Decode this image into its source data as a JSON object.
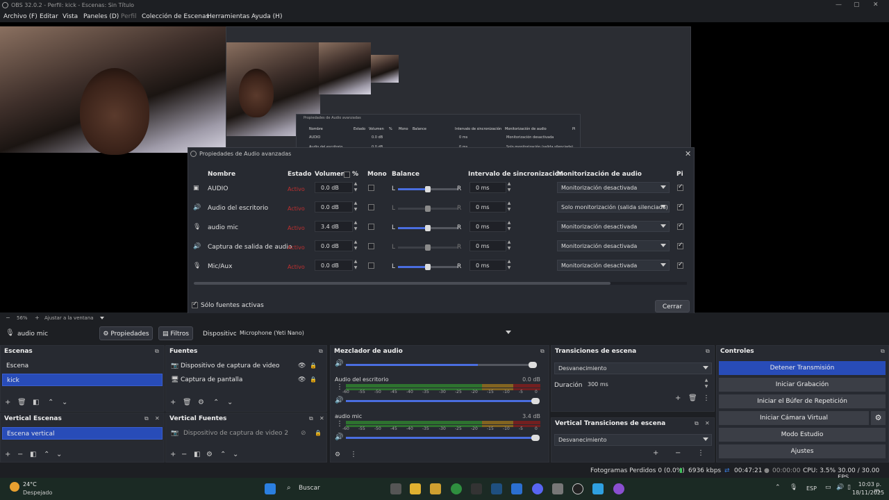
{
  "window": {
    "title": "OBS 32.0.2 - Perfil: kick - Escenas: Sin Título"
  },
  "menu": [
    "Archivo (F)",
    "Editar",
    "Vista",
    "Paneles (D)",
    "Perfil",
    "Colección de Escenas",
    "Herramientas",
    "Ayuda (H)"
  ],
  "nested_preview": {
    "dialog_title": "Propiedades de Audio avanzadas",
    "headers": [
      "Nombre",
      "Estado",
      "Volumen",
      "%",
      "Mono",
      "Balance",
      "Intervalo de sincronización",
      "Monitorización de audio",
      "Pi"
    ],
    "row1": {
      "name": "AUDIO",
      "vol": "0.0 dB",
      "ms": "0 ms",
      "monitor": "Monitorización desactivada"
    },
    "row2": {
      "name": "Audio del escritorio",
      "vol": "0.0 dB",
      "ms": "0 ms",
      "monitor": "Solo monitorización (salida silenciada)"
    }
  },
  "dialog": {
    "title": "Propiedades de Audio avanzadas",
    "headers": {
      "name": "Nombre",
      "state": "Estado",
      "volume": "Volumen",
      "percent": "%",
      "mono": "Mono",
      "balance": "Balance",
      "sync": "Intervalo de sincronización",
      "monitor": "Monitorización de audio",
      "pi": "Pi"
    },
    "balance_left": "L",
    "balance_right": "R",
    "rows": [
      {
        "icon": "source-icon",
        "name": "AUDIO",
        "state": "Activo",
        "volume": "0.0 dB",
        "mono": false,
        "balance_active": true,
        "balance": 0.5,
        "sync": "0 ms",
        "monitor": "Monitorización desactivada",
        "track": true
      },
      {
        "icon": "speaker-icon",
        "name": "Audio del escritorio",
        "state": "Activo",
        "volume": "0.0 dB",
        "mono": false,
        "balance_active": false,
        "balance": 0.5,
        "sync": "0 ms",
        "monitor": "Solo monitorización (salida silenciada)",
        "track": true
      },
      {
        "icon": "mic-icon",
        "name": "audio mic",
        "state": "Activo",
        "volume": "3.4 dB",
        "mono": false,
        "balance_active": true,
        "balance": 0.5,
        "sync": "0 ms",
        "monitor": "Monitorización desactivada",
        "track": true
      },
      {
        "icon": "speaker-icon",
        "name": "Captura de salida de audio",
        "state": "Activo",
        "volume": "0.0 dB",
        "mono": false,
        "balance_active": false,
        "balance": 0.5,
        "sync": "0 ms",
        "monitor": "Monitorización desactivada",
        "track": true
      },
      {
        "icon": "mic-icon",
        "name": "Mic/Aux",
        "state": "Activo",
        "volume": "0.0 dB",
        "mono": false,
        "balance_active": true,
        "balance": 0.5,
        "sync": "0 ms",
        "monitor": "Monitorización desactivada",
        "track": true
      }
    ],
    "active_only_label": "Sólo fuentes activas",
    "active_only_checked": true,
    "close_label": "Cerrar"
  },
  "zoom_bar": {
    "minus": "−",
    "zoom": "56%",
    "plus": "+",
    "fit": "Ajustar a la ventana"
  },
  "source_bar": {
    "source_name": "audio mic",
    "properties": "Propiedades",
    "filters": "Filtros",
    "device_label": "Dispositivo",
    "device_value": "Microphone (Yeti Nano)"
  },
  "scenes": {
    "title": "Escenas",
    "items": [
      "Escena",
      "kick"
    ],
    "selected": 1
  },
  "sources": {
    "title": "Fuentes",
    "items": [
      "Dispositivo de captura de video",
      "Captura de pantalla"
    ]
  },
  "mixer": {
    "title": "Mezclador de audio",
    "master_volume": 0.69,
    "channels": [
      {
        "name": "Audio del escritorio",
        "db": "0.0 dB",
        "volume": 1.0
      },
      {
        "name": "audio mic",
        "db": "3.4 dB",
        "volume": 1.0
      }
    ],
    "ticks": [
      "-60",
      "-55",
      "-50",
      "-45",
      "-40",
      "-35",
      "-30",
      "-25",
      "-20",
      "-15",
      "-10",
      "-5",
      "0"
    ]
  },
  "transitions": {
    "title": "Transiciones de escena",
    "selected": "Desvanecimiento",
    "duration_label": "Duración",
    "duration_value": "300 ms"
  },
  "controls": {
    "title": "Controles",
    "buttons": [
      "Detener Transmisión",
      "Iniciar Grabación",
      "Iniciar el Búfer de Repetición",
      "Iniciar Cámara Virtual",
      "Modo Estudio",
      "Ajustes"
    ]
  },
  "vertical_scenes": {
    "title": "Vertical Escenas",
    "items": [
      "Escena vertical"
    ]
  },
  "vertical_sources": {
    "title": "Vertical Fuentes",
    "items": [
      "Dispositivo de captura de video 2"
    ]
  },
  "vertical_transitions": {
    "title": "Vertical Transiciones de escena",
    "selected": "Desvanecimiento"
  },
  "status": {
    "frames_dropped": "Fotogramas Perdidos 0 (0.0%)",
    "bitrate": "6936 kbps",
    "stream_time": "00:47:21",
    "rec_time": "00:00:00",
    "cpu": "CPU: 3.5%",
    "fps": "30.00 / 30.00 FPS"
  },
  "taskbar": {
    "weather_temp": "24°C",
    "weather_desc": "Despejado",
    "search": "Buscar",
    "lang": "ESP",
    "time": "10:03 p. m.",
    "date": "18/11/2025"
  },
  "colors": {
    "accent": "#284cb8",
    "panel": "#272a31",
    "bg": "#1d1f23",
    "state_red": "#c03030"
  }
}
